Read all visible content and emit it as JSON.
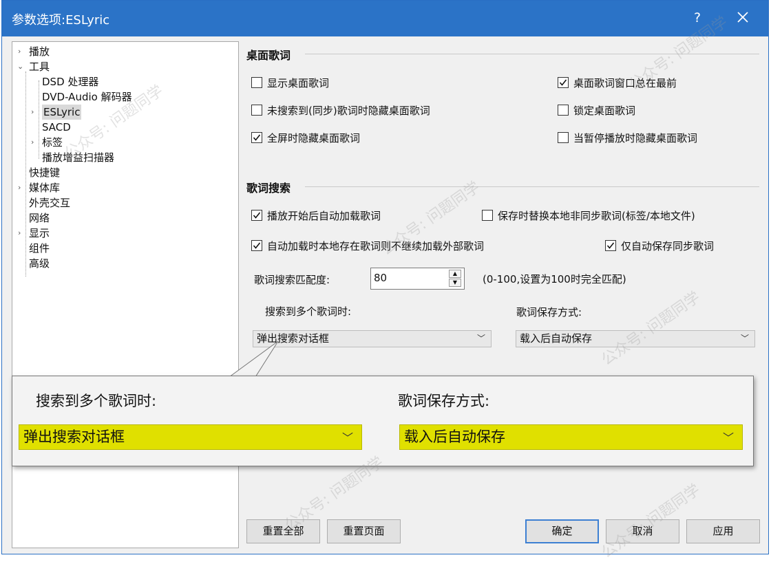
{
  "window": {
    "title": "参数选项:ESLyric",
    "help_glyph": "?"
  },
  "tree": [
    {
      "label": "播放",
      "expander": "collapsed"
    },
    {
      "label": "工具",
      "expander": "expanded"
    },
    {
      "label": "DSD 处理器"
    },
    {
      "label": "DVD-Audio 解码器"
    },
    {
      "label": "ESLyric",
      "expander": "collapsed",
      "selected": true
    },
    {
      "label": "SACD"
    },
    {
      "label": "标签",
      "expander": "collapsed"
    },
    {
      "label": "播放增益扫描器"
    },
    {
      "label": "快捷键"
    },
    {
      "label": "媒体库",
      "expander": "collapsed"
    },
    {
      "label": "外壳交互"
    },
    {
      "label": "网络"
    },
    {
      "label": "显示",
      "expander": "collapsed"
    },
    {
      "label": "组件"
    },
    {
      "label": "高级"
    }
  ],
  "desktop_lyrics": {
    "heading": "桌面歌词",
    "options": [
      {
        "label": "显示桌面歌词",
        "checked": false
      },
      {
        "label": "桌面歌词窗口总在最前",
        "checked": true
      },
      {
        "label": "未搜索到(同步)歌词时隐藏桌面歌词",
        "checked": false
      },
      {
        "label": "锁定桌面歌词",
        "checked": false
      },
      {
        "label": "全屏时隐藏桌面歌词",
        "checked": true
      },
      {
        "label": "当暂停播放时隐藏桌面歌词",
        "checked": false
      }
    ]
  },
  "lyric_search": {
    "heading": "歌词搜索",
    "options": [
      {
        "label": "播放开始后自动加载歌词",
        "checked": true
      },
      {
        "label": "保存时替换本地非同步歌词(标签/本地文件)",
        "checked": false
      },
      {
        "label": "自动加载时本地存在歌词则不继续加载外部歌词",
        "checked": true
      },
      {
        "label": "仅自动保存同步歌词",
        "checked": true
      }
    ],
    "match_label": "歌词搜索匹配度:",
    "match_value": "80",
    "match_hint": "(0-100,设置为100时完全匹配)",
    "multi_label": "搜索到多个歌词时:",
    "multi_value": "弹出搜索对话框",
    "save_label": "歌词保存方式:",
    "save_value": "载入后自动保存"
  },
  "buttons": {
    "reset_all": "重置全部",
    "reset_page": "重置页面",
    "ok": "确定",
    "cancel": "取消",
    "apply": "应用"
  },
  "watermark": "公众号: 问题同学",
  "colors": {
    "titlebar": "#2b73c7",
    "highlight": "#e0e000",
    "accent": "#3c7fd2"
  }
}
